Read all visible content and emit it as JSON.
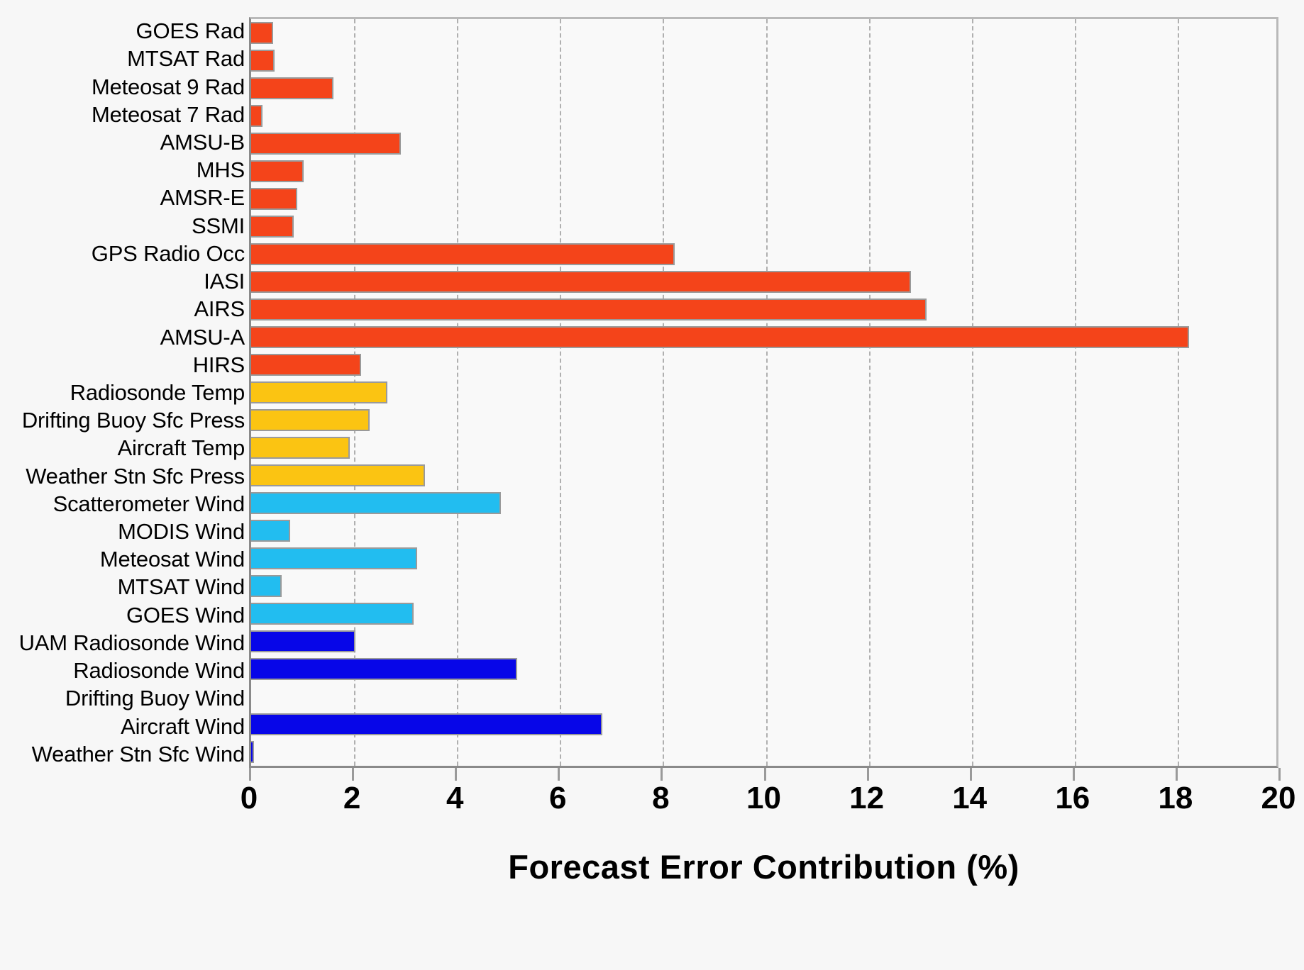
{
  "chart_data": {
    "type": "bar",
    "orientation": "horizontal",
    "title": "",
    "xlabel": "Forecast Error Contribution (%)",
    "ylabel": "",
    "xlim": [
      0,
      20
    ],
    "xticks": [
      0,
      2,
      4,
      6,
      8,
      10,
      12,
      14,
      16,
      18,
      20
    ],
    "xticklabels": [
      "0",
      "2",
      "4",
      "6",
      "8",
      "10",
      "12",
      "14",
      "16",
      "18",
      "20"
    ],
    "grid": "vertical-dashed",
    "legend": "none",
    "categories": [
      "GOES Rad",
      "MTSAT Rad",
      "Meteosat 9 Rad",
      "Meteosat 7 Rad",
      "AMSU-B",
      "MHS",
      "AMSR-E",
      "SSMI",
      "GPS Radio Occ",
      "IASI",
      "AIRS",
      "AMSU-A",
      "HIRS",
      "Radiosonde Temp",
      "Drifting Buoy Sfc Press",
      "Aircraft Temp",
      "Weather Stn Sfc Press",
      "Scatterometer Wind",
      "MODIS Wind",
      "Meteosat Wind",
      "MTSAT Wind",
      "GOES Wind",
      "UAM Radiosonde Wind",
      "Radiosonde Wind",
      "Drifting Buoy Wind",
      "Aircraft Wind",
      "Weather Stn Sfc Wind"
    ],
    "values": [
      0.45,
      0.48,
      1.63,
      0.25,
      2.93,
      1.05,
      0.92,
      0.85,
      8.25,
      12.85,
      13.15,
      18.25,
      2.17,
      2.67,
      2.33,
      1.94,
      3.4,
      4.88,
      0.78,
      3.25,
      0.62,
      3.18,
      2.05,
      5.2,
      0.0,
      6.85,
      0.08
    ],
    "colors": [
      "#F4441A",
      "#F4441A",
      "#F4441A",
      "#F4441A",
      "#F4441A",
      "#F4441A",
      "#F4441A",
      "#F4441A",
      "#F4441A",
      "#F4441A",
      "#F4441A",
      "#F4441A",
      "#F4441A",
      "#FBC412",
      "#FBC412",
      "#FBC412",
      "#FBC412",
      "#22BDF0",
      "#22BDF0",
      "#22BDF0",
      "#22BDF0",
      "#22BDF0",
      "#0706E8",
      "#0706E8",
      "#0706E8",
      "#0706E8",
      "#0706E8"
    ],
    "color_groups": {
      "satellite_radiance": "#F4441A",
      "temperature_pressure": "#FBC412",
      "satellite_wind": "#22BDF0",
      "in_situ_wind": "#0706E8"
    },
    "background": "#f7f7f7",
    "plot_background": "#f9f9f9"
  }
}
